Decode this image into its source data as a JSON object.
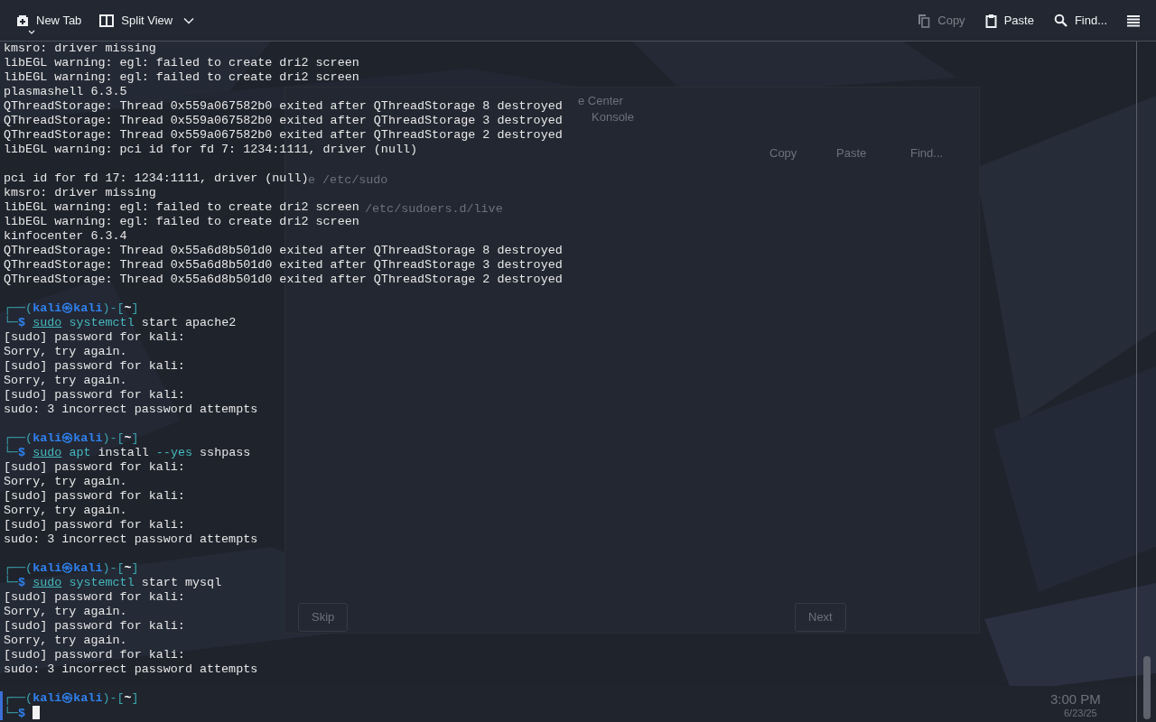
{
  "toolbar": {
    "left": [
      {
        "label": "New Tab",
        "kind": "new_tab",
        "disabled": false
      },
      {
        "label": "Split View",
        "kind": "split_view",
        "disabled": false
      }
    ],
    "right": [
      {
        "label": "Copy",
        "kind": "copy",
        "disabled": true
      },
      {
        "label": "Paste",
        "kind": "paste",
        "disabled": false
      },
      {
        "label": "Find...",
        "kind": "find",
        "disabled": false
      }
    ]
  },
  "terminal": {
    "lines": [
      {
        "kind": "text",
        "text": "kmsro: driver missing"
      },
      {
        "kind": "text",
        "text": "libEGL warning: egl: failed to create dri2 screen"
      },
      {
        "kind": "text",
        "text": "libEGL warning: egl: failed to create dri2 screen"
      },
      {
        "kind": "text",
        "text": "plasmashell 6.3.5"
      },
      {
        "kind": "text",
        "text": "QThreadStorage: Thread 0x559a067582b0 exited after QThreadStorage 8 destroyed"
      },
      {
        "kind": "text",
        "text": "QThreadStorage: Thread 0x559a067582b0 exited after QThreadStorage 3 destroyed"
      },
      {
        "kind": "text",
        "text": "QThreadStorage: Thread 0x559a067582b0 exited after QThreadStorage 2 destroyed"
      },
      {
        "kind": "text",
        "text": "libEGL warning: pci id for fd 7: 1234:1111, driver (null)"
      },
      {
        "kind": "blank"
      },
      {
        "kind": "text",
        "text": "pci id for fd 17: 1234:1111, driver (null)"
      },
      {
        "kind": "text",
        "text": "kmsro: driver missing"
      },
      {
        "kind": "text",
        "text": "libEGL warning: egl: failed to create dri2 screen"
      },
      {
        "kind": "text",
        "text": "libEGL warning: egl: failed to create dri2 screen"
      },
      {
        "kind": "text",
        "text": "kinfocenter 6.3.4"
      },
      {
        "kind": "text",
        "text": "QThreadStorage: Thread 0x55a6d8b501d0 exited after QThreadStorage 8 destroyed"
      },
      {
        "kind": "text",
        "text": "QThreadStorage: Thread 0x55a6d8b501d0 exited after QThreadStorage 3 destroyed"
      },
      {
        "kind": "text",
        "text": "QThreadStorage: Thread 0x55a6d8b501d0 exited after QThreadStorage 2 destroyed"
      },
      {
        "kind": "blank"
      },
      {
        "kind": "prompt",
        "open": "┌──(",
        "user": "kali",
        "sep": "㉿",
        "host": "kali",
        "mid": ")-[",
        "dir": "~",
        "close": "]",
        "lead": "└─",
        "symbol": "$",
        "cursor": false,
        "command": [
          {
            "text": "sudo",
            "kind": "underlined"
          },
          {
            "text": "systemctl",
            "kind": "command"
          },
          {
            "text": "start",
            "kind": "arg"
          },
          {
            "text": "apache2",
            "kind": "arg"
          }
        ]
      },
      {
        "kind": "text",
        "text": "[sudo] password for kali:"
      },
      {
        "kind": "text",
        "text": "Sorry, try again."
      },
      {
        "kind": "text",
        "text": "[sudo] password for kali:"
      },
      {
        "kind": "text",
        "text": "Sorry, try again."
      },
      {
        "kind": "text",
        "text": "[sudo] password for kali:"
      },
      {
        "kind": "text",
        "text": "sudo: 3 incorrect password attempts"
      },
      {
        "kind": "blank"
      },
      {
        "kind": "prompt",
        "open": "┌──(",
        "user": "kali",
        "sep": "㉿",
        "host": "kali",
        "mid": ")-[",
        "dir": "~",
        "close": "]",
        "lead": "└─",
        "symbol": "$",
        "cursor": false,
        "command": [
          {
            "text": "sudo",
            "kind": "underlined"
          },
          {
            "text": "apt",
            "kind": "command"
          },
          {
            "text": "install",
            "kind": "arg"
          },
          {
            "text": "--yes",
            "kind": "option"
          },
          {
            "text": "sshpass",
            "kind": "arg"
          }
        ]
      },
      {
        "kind": "text",
        "text": "[sudo] password for kali:"
      },
      {
        "kind": "text",
        "text": "Sorry, try again."
      },
      {
        "kind": "text",
        "text": "[sudo] password for kali:"
      },
      {
        "kind": "text",
        "text": "Sorry, try again."
      },
      {
        "kind": "text",
        "text": "[sudo] password for kali:"
      },
      {
        "kind": "text",
        "text": "sudo: 3 incorrect password attempts"
      },
      {
        "kind": "blank"
      },
      {
        "kind": "prompt",
        "open": "┌──(",
        "user": "kali",
        "sep": "㉿",
        "host": "kali",
        "mid": ")-[",
        "dir": "~",
        "close": "]",
        "lead": "└─",
        "symbol": "$",
        "cursor": false,
        "command": [
          {
            "text": "sudo",
            "kind": "underlined"
          },
          {
            "text": "systemctl",
            "kind": "command"
          },
          {
            "text": "start",
            "kind": "arg"
          },
          {
            "text": "mysql",
            "kind": "arg"
          }
        ]
      },
      {
        "kind": "text",
        "text": "[sudo] password for kali:"
      },
      {
        "kind": "text",
        "text": "Sorry, try again."
      },
      {
        "kind": "text",
        "text": "[sudo] password for kali:"
      },
      {
        "kind": "text",
        "text": "Sorry, try again."
      },
      {
        "kind": "text",
        "text": "[sudo] password for kali:"
      },
      {
        "kind": "text",
        "text": "sudo: 3 incorrect password attempts"
      },
      {
        "kind": "blank"
      },
      {
        "kind": "prompt",
        "open": "┌──(",
        "user": "kali",
        "sep": "㉿",
        "host": "kali",
        "mid": ")-[",
        "dir": "~",
        "close": "]",
        "lead": "└─",
        "symbol": "$",
        "cursor": true
      }
    ]
  },
  "background": {
    "window_titles": [
      "e Center",
      "Konsole"
    ],
    "toolbar": [
      "Copy",
      "Paste",
      "Find..."
    ],
    "lines": [
      "e /etc/sudo",
      "/etc/sudoers.d/live"
    ],
    "buttons": [
      "Skip",
      "Next"
    ],
    "clock": {
      "time": "3:00 PM",
      "date": "6/23/25"
    }
  }
}
